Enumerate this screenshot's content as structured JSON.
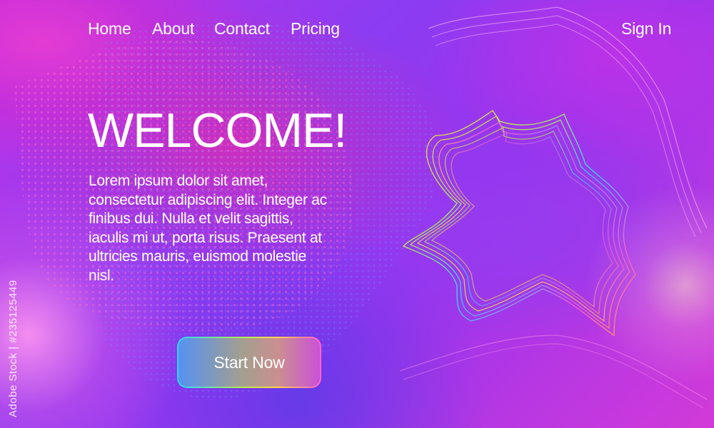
{
  "nav": {
    "items": [
      {
        "label": "Home"
      },
      {
        "label": "About"
      },
      {
        "label": "Contact"
      },
      {
        "label": "Pricing"
      }
    ],
    "sign_in": "Sign In"
  },
  "hero": {
    "title": "WELCOME!",
    "body": "Lorem ipsum dolor sit amet, consectetur adipiscing elit. Integer ac finibus dui. Nulla et velit sagittis, iaculis mi ut, porta risus. Praesent at ultricies mauris, euismod molestie nisl.",
    "cta_label": "Start Now"
  },
  "watermark": {
    "stock_text": "Adobe Stock | #235125449"
  },
  "colors": {
    "text": "#ffffff",
    "background_magenta": "#c233e6",
    "background_violet": "#8b3cf2",
    "button_border_cyan": "#28d8ff",
    "button_border_lime": "#b7f04a",
    "button_border_yellow": "#ffd34a",
    "button_border_pink": "#ff5fd0"
  }
}
